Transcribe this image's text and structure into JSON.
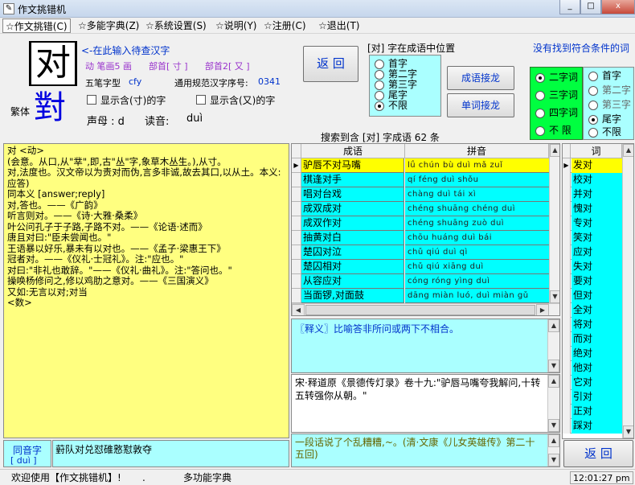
{
  "window": {
    "title": "作文挑错机",
    "min": "_",
    "max": "□",
    "close": "x"
  },
  "menu": [
    {
      "label": "☆作文挑错(C)"
    },
    {
      "label": "☆多能字典(Z)"
    },
    {
      "label": "☆系统设置(S)"
    },
    {
      "label": "☆说明(Y)"
    },
    {
      "label": "☆注册(C)"
    },
    {
      "label": "☆退出(T)"
    }
  ],
  "char": {
    "simplified": "对",
    "traditional": "對",
    "traditional_label": "繁体",
    "input_hint": "<-在此输入待查汉字",
    "strokes": "动 笔画5 画",
    "radical1": "部首[ 寸 ]",
    "radical2": "部首2[ 又 ]",
    "wubi_label": "五笔字型",
    "wubi_code": "cfy",
    "std_label": "通用规范汉字序号:",
    "std_number": "0341",
    "check1": "显示含(寸)的字",
    "check2": "显示含(又)的字",
    "tone_label": "声母 : d",
    "reading_label": "读音:",
    "reading": "duì"
  },
  "buttons": {
    "back_top": "返 回",
    "idiom_chain": "成语接龙",
    "word_chain": "单词接龙",
    "back_bottom": "返 回"
  },
  "position": {
    "title": "[对] 字在成语中位置",
    "options": [
      "首字",
      "第二字",
      "第三字",
      "尾字",
      "不限"
    ],
    "selected": 4
  },
  "no_match": "没有找到符合条件的词",
  "length": {
    "options": [
      "二字词",
      "三字词",
      "四字词",
      "不 限"
    ],
    "selected": 0
  },
  "position2": {
    "options": [
      "首字",
      "第二字",
      "第三字",
      "尾字",
      "不限"
    ],
    "selected": 3
  },
  "search_result": "搜索到含 [对] 字成语 62 条",
  "definition": [
    "对 <动>",
    "(会意。从口,从\"丵\",即,古\"丛\"字,象草木丛生。),从寸。",
    "对,法度也。汉文帝以为责对而伪,言多非诚,故去其口,以从土。本义:应答)",
    "同本义 [answer;reply]",
    "对,答也。——《广韵》",
    "听言则对。——《诗·大雅·桑柔》",
    "叶公问孔子于子路,子路不对。——《论语·述而》",
    "唐且对曰:\"臣未尝闻也。\"",
    "王语暴以好乐,暴未有以对也。——《孟子·梁惠王下》",
    "冠者对。——《仪礼·士冠礼》。注:\"应也。\"",
    "对曰:\"非礼也敢辞。\"——《仪礼·曲礼》。注:\"答问也。\"",
    "操唤杨修问之,修以鸡肋之意对。——《三国演义》",
    "又如:无言以对;对当",
    "<数>"
  ],
  "idiom_table": {
    "headers": [
      "成语",
      "拼音"
    ],
    "rows": [
      {
        "idiom": "驴唇不对马嘴",
        "pinyin": "lǘ chún bù duì mǎ zuǐ"
      },
      {
        "idiom": "棋逢对手",
        "pinyin": "qí féng duì shǒu"
      },
      {
        "idiom": "唱对台戏",
        "pinyin": "chàng duì tái xì"
      },
      {
        "idiom": "成双成对",
        "pinyin": "chéng shuāng chéng duì"
      },
      {
        "idiom": "成双作对",
        "pinyin": "chéng shuāng zuò duì"
      },
      {
        "idiom": "抽黄对白",
        "pinyin": "chōu huáng duì bái"
      },
      {
        "idiom": "楚囚对泣",
        "pinyin": "chǔ qiú duì qì"
      },
      {
        "idiom": "楚囚相对",
        "pinyin": "chǔ qiú xiāng duì"
      },
      {
        "idiom": "从容应对",
        "pinyin": "cóng róng yìng duì"
      },
      {
        "idiom": "当面锣,对面鼓",
        "pinyin": "dāng miàn luó, duì miàn gǔ"
      }
    ],
    "selected": 0
  },
  "explanation": "〖释义〗比喻答非所问或两下不相合。",
  "source": "宋·释道原《景德传灯录》卷十九:\"驴唇马嘴夸我解问,十转五转强你从朝。\"",
  "example": "一段话说了个乱糟糟,~。(清·文康《儿女英雄传》第二十五回)",
  "word_list": {
    "header": "词",
    "items": [
      "发对",
      "校对",
      "并对",
      "愧对",
      "专对",
      "笑对",
      "应对",
      "失对",
      "要对",
      "但对",
      "全对",
      "将对",
      "而对",
      "绝对",
      "他对",
      "它对",
      "引对",
      "正对",
      "踩对"
    ],
    "selected": 0
  },
  "homophone": {
    "label": "同音字",
    "reading": "[ duì ]",
    "chars": "薱队对兑怼碓憝懟敦夺"
  },
  "status": {
    "welcome": "欢迎使用【作文挑错机】!",
    "dot": ".",
    "module": "多功能字典",
    "time": "12:01:27 pm"
  }
}
